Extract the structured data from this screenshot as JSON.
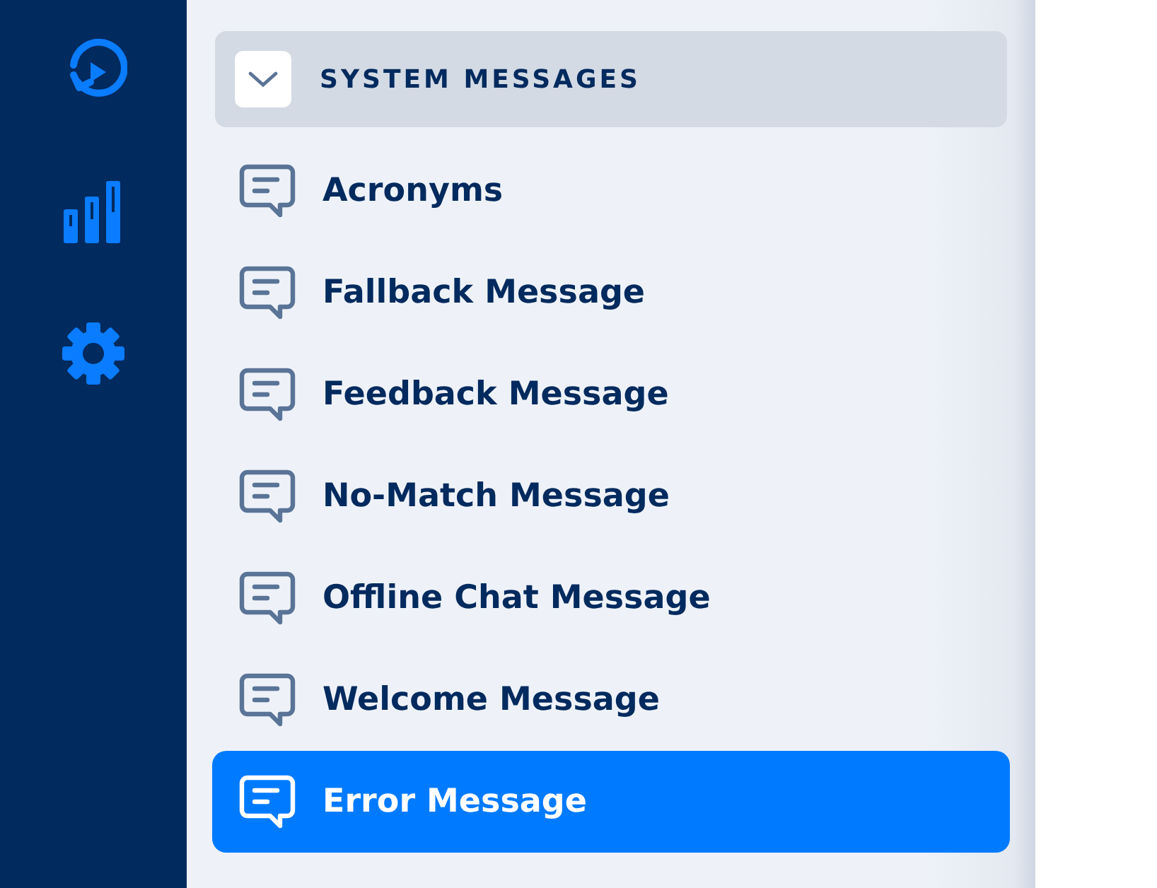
{
  "rail": {
    "items": [
      {
        "kind": "replay"
      },
      {
        "kind": "analytics"
      },
      {
        "kind": "settings"
      }
    ]
  },
  "section": {
    "title": "SYSTEM MESSAGES",
    "expanded": true
  },
  "messages": [
    {
      "label": "Acronyms",
      "selected": false
    },
    {
      "label": "Fallback Message",
      "selected": false
    },
    {
      "label": "Feedback Message",
      "selected": false
    },
    {
      "label": "No-Match Message",
      "selected": false
    },
    {
      "label": "Offline Chat Message",
      "selected": false
    },
    {
      "label": "Welcome Message",
      "selected": false
    },
    {
      "label": "Error Message",
      "selected": true
    }
  ]
}
